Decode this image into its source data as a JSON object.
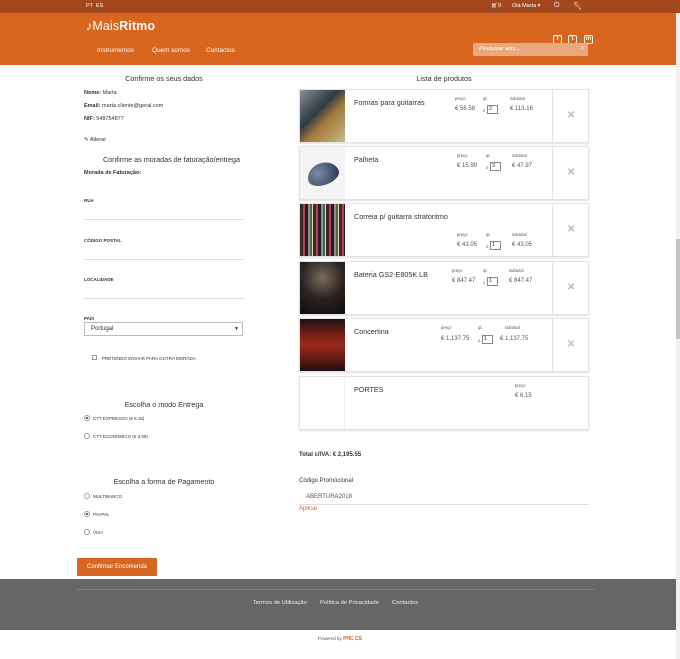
{
  "topbar": {
    "lang_pt": "PT",
    "lang_es": "ES",
    "cart_count": "9",
    "user": "Olá Marta ▾"
  },
  "header": {
    "logo_prefix": "Mais",
    "logo_suffix": "Ritmo",
    "nav": [
      "Instrumentos",
      "Quem somos",
      "Contactos"
    ],
    "search_placeholder": "Pesquisar aqui..."
  },
  "left": {
    "confirm_title": "Confirme os seus dados",
    "name_label": "Nome:",
    "name_value": "Marta",
    "email_label": "Email:",
    "email_value": "marta.cliente@geral.com",
    "nif_label": "NIF:",
    "nif_value": "548754877",
    "alter_label": "Alterar",
    "address_title": "Confirme as moradas de faturação/entrega",
    "billing_label": "Morada de Faturação:",
    "rua": "RUA",
    "codigo_postal": "CÓDIGO POSTAL",
    "localidade": "LOCALIDADE",
    "pais": "PAÍS",
    "country_value": "Portugal",
    "other_address": "PRETENDO ENVIAR PARA OUTRA MORADA",
    "delivery_title": "Escolha o modo Entrega",
    "delivery_options": [
      "CTT EXPRESSO (€ 6.15)",
      "CTT ECONÓMICO (€ 3.08)"
    ],
    "payment_title": "Escolha a forma de Pagamento",
    "payment_options": [
      "MULTIBANCO",
      "PAYPAL",
      "VISA"
    ],
    "confirm_button": "Confirmar Encomenda"
  },
  "right": {
    "title": "Lista de produtos",
    "col_price": "preço",
    "col_qty": "qt.",
    "col_subtotal": "subtotal",
    "products": [
      {
        "name": "Formas para guitarras",
        "price": "€ 56.58",
        "qty": "2",
        "subtotal": "€ 113.16"
      },
      {
        "name": "Palheta",
        "price": "€ 15.99",
        "qty": "3",
        "subtotal": "€ 47.97"
      },
      {
        "name": "Correia p/ guitarra stratoritmo",
        "price": "€ 43.05",
        "qty": "1",
        "subtotal": "€ 43.05"
      },
      {
        "name": "Bateria GS2-E805K LB",
        "price": "€ 847.47",
        "qty": "1",
        "subtotal": "€ 847.47"
      },
      {
        "name": "Concertina",
        "price": "€ 1,137.75",
        "qty": "1",
        "subtotal": "€ 1,137.75"
      }
    ],
    "portes": {
      "name": "PORTES",
      "price_label": "preço",
      "price": "€ 6.15"
    },
    "total": "Total c/IVA: € 2,195.55",
    "promo_label": "Código Promocional",
    "promo_value": "ABERTURA2018",
    "apply": "Aplicar"
  },
  "footer": {
    "links": [
      "Termos de Utilização",
      "Política de Privacidade",
      "Contactos"
    ],
    "powered": "Powered by",
    "brand": "PHC CS"
  },
  "colors": {
    "accent": "#d8661f",
    "topbar": "#a4471c",
    "footer": "#666666"
  }
}
